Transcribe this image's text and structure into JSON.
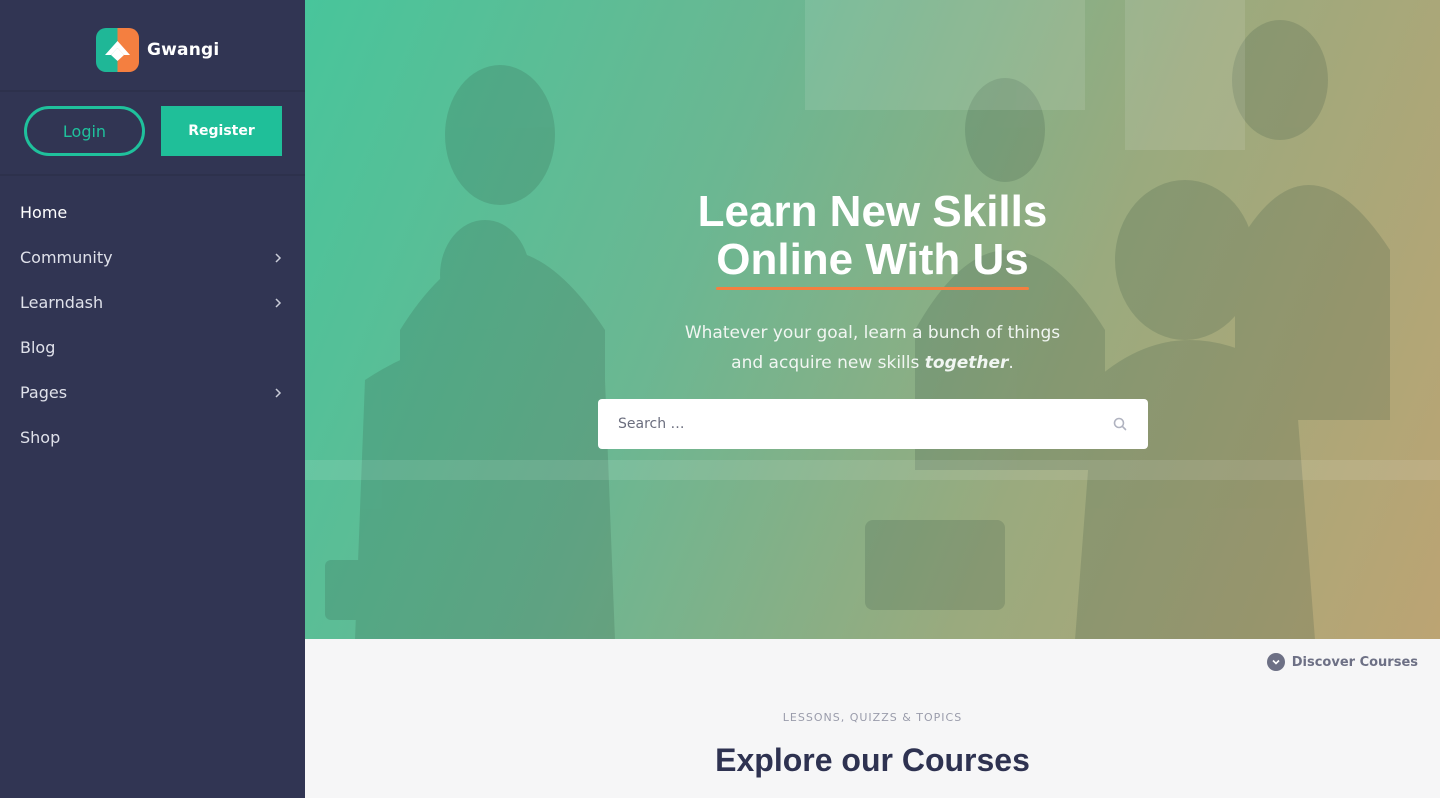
{
  "brand": {
    "name": "Gwangi"
  },
  "auth": {
    "login_label": "Login",
    "register_label": "Register"
  },
  "nav": {
    "items": [
      {
        "label": "Home",
        "has_submenu": false
      },
      {
        "label": "Community",
        "has_submenu": true
      },
      {
        "label": "Learndash",
        "has_submenu": true
      },
      {
        "label": "Blog",
        "has_submenu": false
      },
      {
        "label": "Pages",
        "has_submenu": true
      },
      {
        "label": "Shop",
        "has_submenu": false
      }
    ]
  },
  "hero": {
    "title_line1": "Learn New Skills",
    "title_line2": "Online With Us",
    "subtitle_line1": "Whatever your goal, learn a bunch of things",
    "subtitle_line2_prefix": "and acquire new skills ",
    "subtitle_line2_emphasis": "together",
    "subtitle_line2_suffix": ".",
    "search_placeholder": "Search …"
  },
  "discover": {
    "label": "Discover Courses"
  },
  "courses_section": {
    "eyebrow": "LESSONS, QUIZZS & TOPICS",
    "title": "Explore our Courses"
  },
  "colors": {
    "sidebar_bg": "#313553",
    "accent_green": "#1fbf99",
    "accent_orange": "#f47f40",
    "title_navy": "#2e3251"
  },
  "icons": {
    "logo": "gwangi-logo-icon",
    "chevron": "chevron-right-icon",
    "search": "search-icon",
    "discover": "chevron-down-circle-icon"
  }
}
